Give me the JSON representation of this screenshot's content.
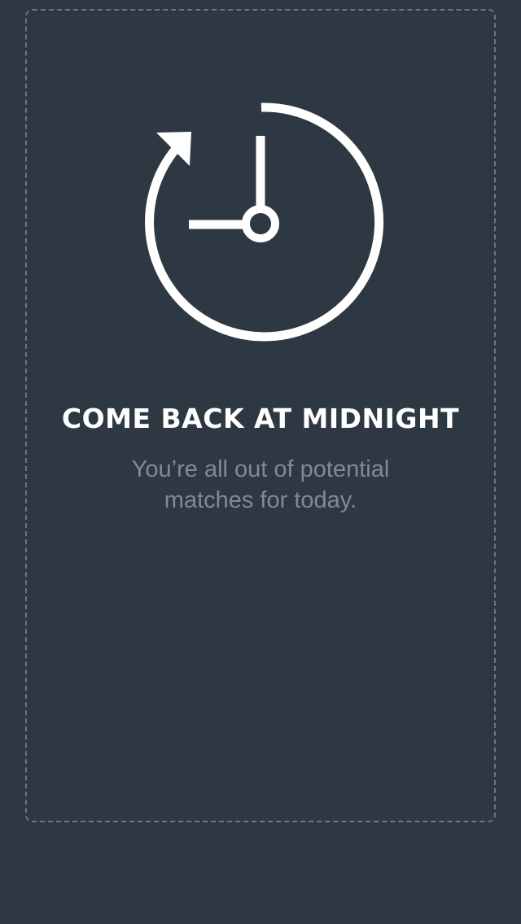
{
  "empty_state": {
    "icon": "clock-reset-icon",
    "title": "COME BACK AT MIDNIGHT",
    "message": "You’re all out of potential matches for today."
  },
  "colors": {
    "background": "#2d3842",
    "card_border": "#6b7680",
    "title_text": "#ffffff",
    "message_text": "#7f8a94",
    "icon": "#ffffff"
  }
}
